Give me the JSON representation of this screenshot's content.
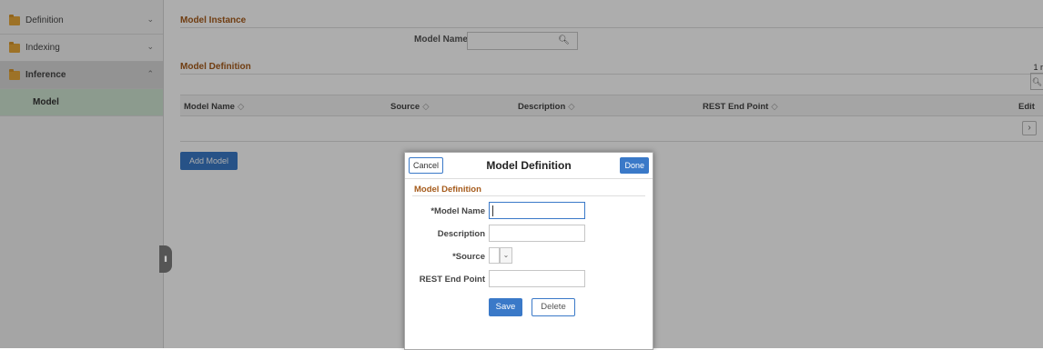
{
  "sidebar": {
    "items": [
      {
        "label": "Definition",
        "chevron": "⌄"
      },
      {
        "label": "Indexing",
        "chevron": "⌄"
      },
      {
        "label": "Inference",
        "chevron": "⌃"
      },
      {
        "label": "Model"
      }
    ]
  },
  "main": {
    "model_instance_title": "Model Instance",
    "model_name_label": "Model Name",
    "model_definition_title": "Model Definition",
    "rows_count": "1 r",
    "columns": [
      "Model Name",
      "Source",
      "Description",
      "REST End Point",
      "Edit"
    ],
    "sort_glyph": "◇",
    "add_model_label": "Add Model"
  },
  "modal": {
    "cancel_label": "Cancel",
    "title": "Model Definition",
    "done_label": "Done",
    "section_title": "Model Definition",
    "fields": {
      "model_name_label": "*Model Name",
      "description_label": "Description",
      "source_label": "*Source",
      "rest_label": "REST End Point"
    },
    "save_label": "Save",
    "delete_label": "Delete"
  },
  "icons": {
    "search": "magnifier-icon",
    "edit": "chevron-right-icon",
    "collapse": "pause-icon"
  }
}
